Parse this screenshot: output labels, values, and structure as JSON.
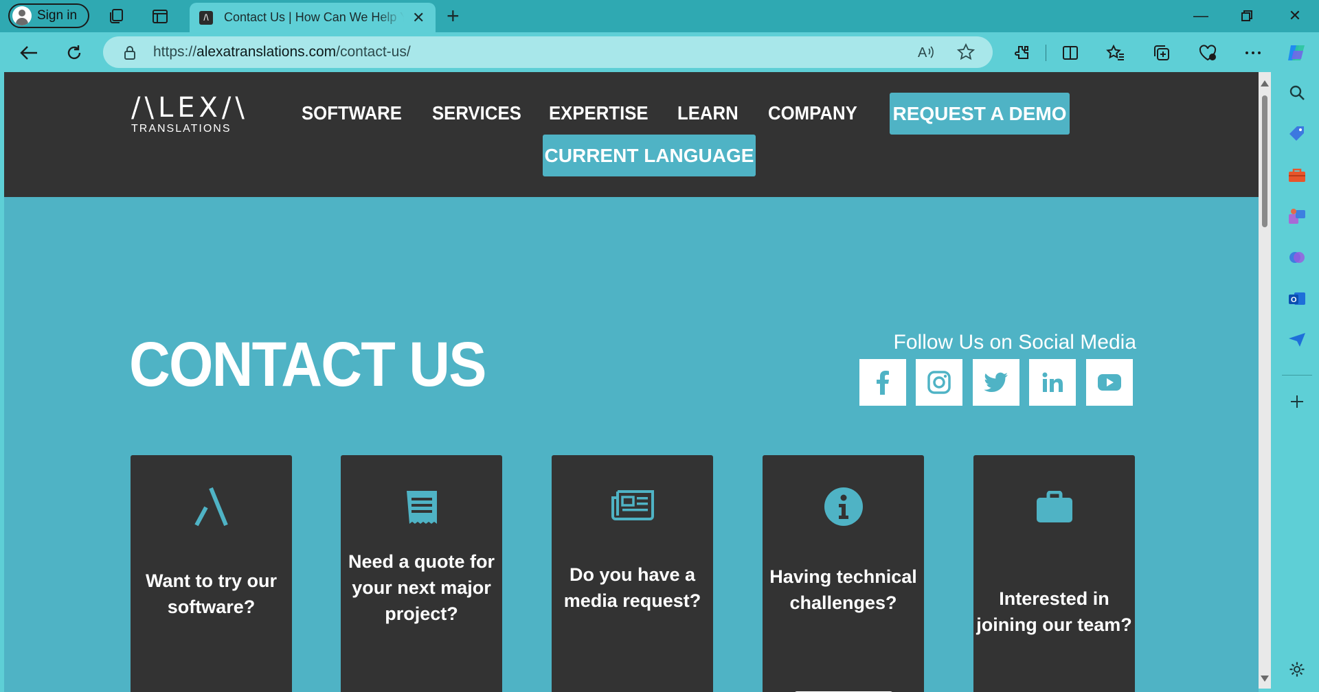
{
  "browser": {
    "signin_label": "Sign in",
    "tab_title": "Contact Us | How Can We Help You | Alexa Translations",
    "tab_favicon": "/\\",
    "url_prefix": "https://",
    "url_domain": "alexatranslations.com",
    "url_path": "/contact-us/"
  },
  "site": {
    "logo_word": "/\\LEX/\\",
    "logo_sub": "TRANSLATIONS",
    "menu": [
      "SOFTWARE",
      "SERVICES",
      "EXPERTISE",
      "LEARN",
      "COMPANY"
    ],
    "demo_button": "REQUEST A DEMO",
    "language_button": "CURRENT LANGUAGE"
  },
  "hero": {
    "title": "CONTACT US",
    "follow_label": "Follow Us on Social Media",
    "social": [
      "facebook-icon",
      "instagram-icon",
      "twitter-icon",
      "linkedin-icon",
      "youtube-icon"
    ]
  },
  "cards": [
    {
      "icon": "alexa-logo-icon",
      "text": "Want to try our software?"
    },
    {
      "icon": "receipt-icon",
      "text": "Need a quote for your next major project?"
    },
    {
      "icon": "newspaper-icon",
      "text": "Do you have a media request?"
    },
    {
      "icon": "info-icon",
      "text": "Having technical challenges?"
    },
    {
      "icon": "briefcase-icon",
      "text": "Interested in joining our team?"
    }
  ],
  "colors": {
    "chrome": "#5ecfd6",
    "header": "#333333",
    "accent": "#4fb3c5"
  }
}
